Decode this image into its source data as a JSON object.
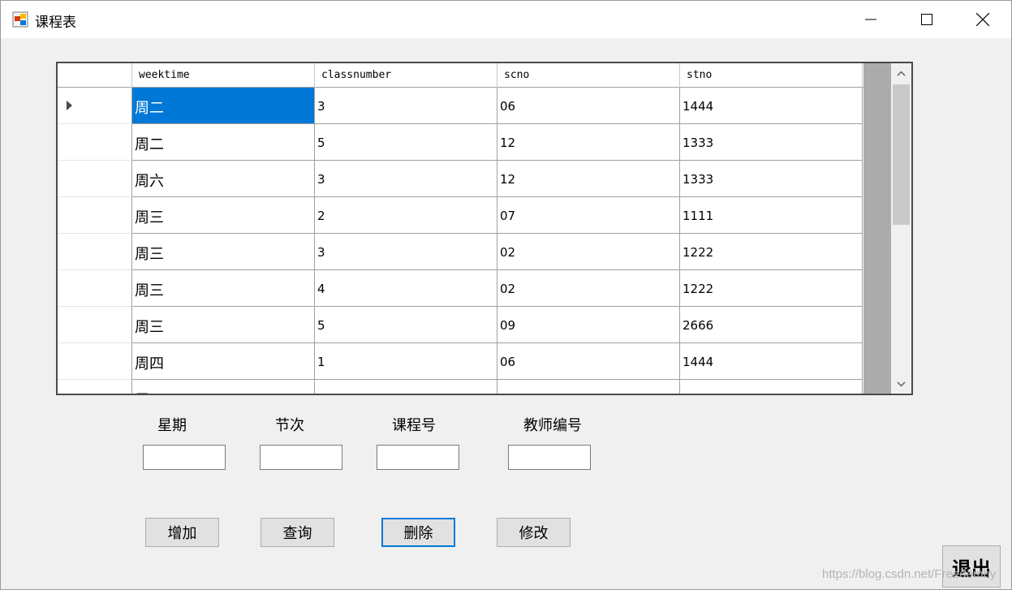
{
  "window": {
    "title": "课程表",
    "icon": "app-form-icon",
    "controls": [
      "minimize-icon",
      "maximize-icon",
      "close-icon"
    ]
  },
  "grid": {
    "columns": [
      "weektime",
      "classnumber",
      "scno",
      "stno"
    ],
    "selected_row": 0,
    "rows": [
      [
        "周二",
        "3",
        "06",
        "1444"
      ],
      [
        "周二",
        "5",
        "12",
        "1333"
      ],
      [
        "周六",
        "3",
        "12",
        "1333"
      ],
      [
        "周三",
        "2",
        "07",
        "1111"
      ],
      [
        "周三",
        "3",
        "02",
        "1222"
      ],
      [
        "周三",
        "4",
        "02",
        "1222"
      ],
      [
        "周三",
        "5",
        "09",
        "2666"
      ],
      [
        "周四",
        "1",
        "06",
        "1444"
      ],
      [
        "周五",
        "",
        "",
        ""
      ]
    ]
  },
  "form": {
    "weekday_label": "星期",
    "period_label": "节次",
    "course_no_label": "课程号",
    "teacher_no_label": "教师编号",
    "weekday_value": "",
    "period_value": "",
    "course_no_value": "",
    "teacher_no_value": ""
  },
  "buttons": {
    "add": "增加",
    "query": "查询",
    "delete": "删除",
    "modify": "修改",
    "exit": "退出"
  },
  "watermark": "https://blog.csdn.net/Freedomhy",
  "colors": {
    "selection": "#0078d7",
    "focus_border": "#0078d7",
    "button_face": "#e1e1e1",
    "background": "#f0f0f0"
  }
}
